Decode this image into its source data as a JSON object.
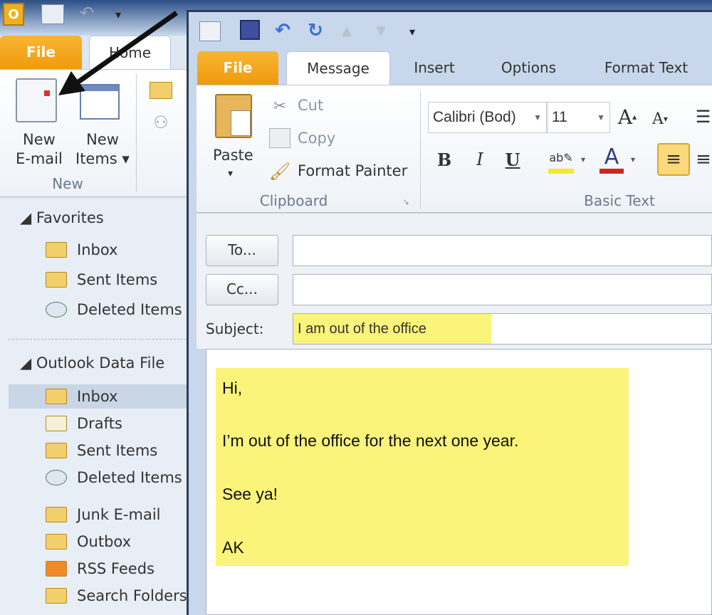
{
  "main_window": {
    "tabs": [
      {
        "label": "File"
      },
      {
        "label": "Home"
      }
    ],
    "ribbon": {
      "new_email": [
        "New",
        "E-mail"
      ],
      "new_items": [
        "New",
        "Items ▾"
      ],
      "group_new": "New"
    },
    "nav": {
      "favorites": "Favorites",
      "favorite_items": [
        "Inbox",
        "Sent Items",
        "Deleted Items"
      ],
      "data_file": "Outlook Data File",
      "data_file_items": [
        "Inbox",
        "Drafts",
        "Sent Items",
        "Deleted Items",
        "Junk E-mail",
        "Outbox",
        "RSS Feeds",
        "Search Folders"
      ],
      "selected": "Inbox"
    }
  },
  "compose": {
    "tabs": [
      {
        "label": "File"
      },
      {
        "label": "Message"
      },
      {
        "label": "Insert"
      },
      {
        "label": "Options"
      },
      {
        "label": "Format Text"
      }
    ],
    "clipboard": {
      "paste": "Paste",
      "cut": "Cut",
      "copy": "Copy",
      "format_painter": "Format Painter",
      "group": "Clipboard"
    },
    "basic_text": {
      "font": "Calibri (Body)",
      "font_display": "Calibri (Bod)",
      "size": "11",
      "bold": "B",
      "italic": "I",
      "underline": "U",
      "group": "Basic Text"
    },
    "to_button": "To...",
    "cc_button": "Cc...",
    "subject_label": "Subject:",
    "to_value": "",
    "cc_value": "",
    "subject_value": "I am out of the office",
    "body_lines": [
      "Hi,",
      "I’m out of the office for the next one year.",
      "See ya!",
      "AK"
    ]
  },
  "colors": {
    "file_tab": "#f09a0c",
    "highlight": "#fbf47a",
    "selected_folder": "#c9d6e6"
  }
}
